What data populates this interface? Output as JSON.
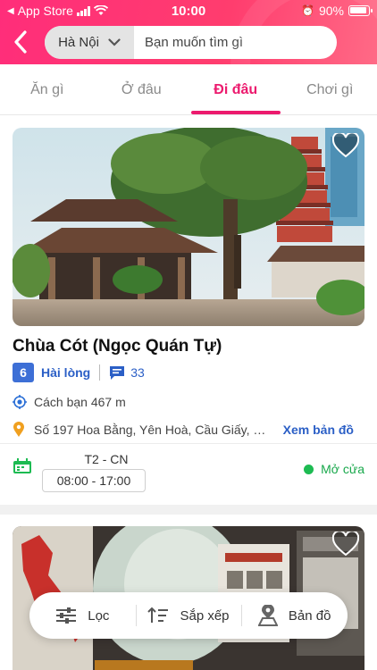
{
  "status_bar": {
    "carrier": "App Store",
    "time": "10:00",
    "battery": "90%"
  },
  "header": {
    "city": "Hà Nội",
    "search_placeholder": "Bạn muốn tìm gì"
  },
  "tabs": [
    {
      "label": "Ăn gì",
      "active": false
    },
    {
      "label": "Ở đâu",
      "active": false
    },
    {
      "label": "Đi đâu",
      "active": true
    },
    {
      "label": "Chơi gì",
      "active": false
    }
  ],
  "place": {
    "name": "Chùa Cót (Ngọc Quán Tự)",
    "score": "6",
    "rating_word": "Hài lòng",
    "comment_count": "33",
    "distance": "Cách bạn 467 m",
    "address": "Số 197 Hoa Bằng, Yên Hoà, Cầu Giấy, Hà Nội",
    "map_link": "Xem bản đồ",
    "days": "T2 - CN",
    "hours": "08:00 - 17:00",
    "open_status": "Mở cửa"
  },
  "bottom_bar": {
    "filter": "Lọc",
    "sort": "Sắp xếp",
    "map": "Bản đồ"
  },
  "colors": {
    "brand": "#ec1a6e",
    "link": "#2b5fc6",
    "open": "#1dbb52"
  }
}
